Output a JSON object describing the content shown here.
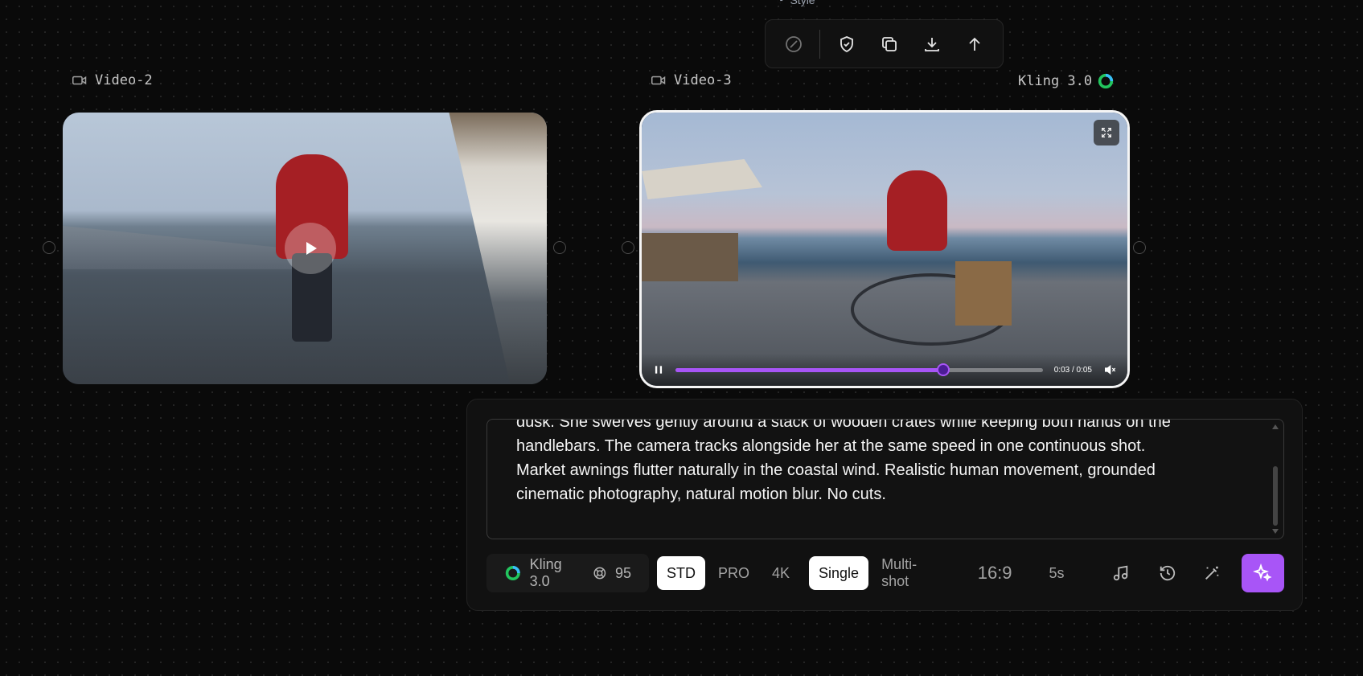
{
  "toolbar": {
    "style_label": "Style",
    "buttons": [
      "disable-icon",
      "shield-check-icon",
      "copy-icon",
      "download-icon",
      "upload-icon"
    ]
  },
  "nodes": {
    "video2": {
      "label": "Video-2"
    },
    "video3": {
      "label": "Video-3",
      "model_label": "Kling 3.0",
      "time": "0:03 / 0:05",
      "progress": 0.73
    }
  },
  "prompt": {
    "text": "dusk. She swerves gently around a stack of wooden crates while keeping both hands on the handlebars. The camera tracks alongside her at the same speed in one continuous shot. Market awnings flutter naturally in the coastal wind. Realistic human movement, grounded cinematic photography, natural motion blur. No cuts."
  },
  "controls": {
    "model": "Kling 3.0",
    "credits": "95",
    "quality": [
      "STD",
      "PRO",
      "4K"
    ],
    "quality_selected": "STD",
    "shot": [
      "Single",
      "Multi-shot"
    ],
    "shot_selected": "Single",
    "aspect_ratio": "16:9",
    "duration": "5s"
  },
  "colors": {
    "accent": "#a855f7",
    "background": "#0a0a0a"
  }
}
